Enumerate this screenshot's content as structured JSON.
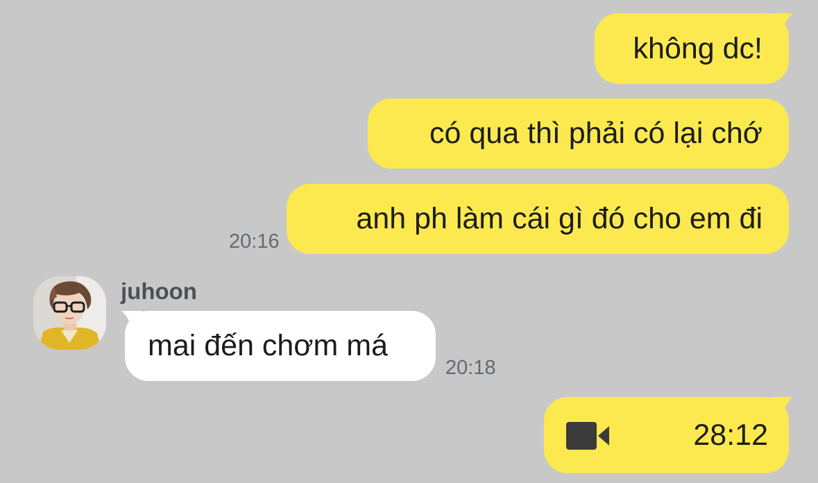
{
  "messages": {
    "m1": {
      "text": "không dc!"
    },
    "m2": {
      "text": "có qua thì phải có lại chớ"
    },
    "m3": {
      "text": "anh ph làm cái gì đó cho em đi",
      "time": "20:16"
    },
    "m4": {
      "sender": "juhoon",
      "text": "mai đến chơm má",
      "time": "20:18"
    },
    "m5": {
      "icon": "video-camera-icon",
      "duration": "28:12"
    }
  },
  "colors": {
    "background": "#c8c8c8",
    "outgoing_bubble": "#fbe94f",
    "incoming_bubble": "#ffffff",
    "timestamp": "#606a72"
  }
}
